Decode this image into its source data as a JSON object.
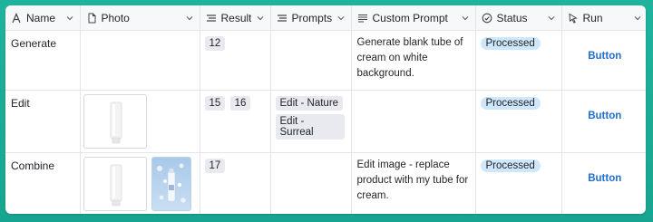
{
  "columns": [
    {
      "label": "Name",
      "icon": "text-icon"
    },
    {
      "label": "Photo",
      "icon": "document-icon"
    },
    {
      "label": "Results",
      "icon": "list-icon"
    },
    {
      "label": "Prompts",
      "icon": "list-icon"
    },
    {
      "label": "Custom Prompt",
      "icon": "paragraph-icon"
    },
    {
      "label": "Status",
      "icon": "status-circle-icon"
    },
    {
      "label": "Run",
      "icon": "cursor-icon"
    }
  ],
  "rows": [
    {
      "name": "Generate",
      "results": [
        "12"
      ],
      "prompts": [],
      "custom_prompt": "Generate blank tube of cream on white background.",
      "status": "Processed",
      "run_label": "Button"
    },
    {
      "name": "Edit",
      "results": [
        "15",
        "16"
      ],
      "prompts": [
        "Edit - Nature",
        "Edit - Surreal"
      ],
      "custom_prompt": "",
      "status": "Processed",
      "run_label": "Button"
    },
    {
      "name": "Combine",
      "results": [
        "17"
      ],
      "prompts": [],
      "custom_prompt": "Edit image - replace product with my tube for cream.",
      "status": "Processed",
      "run_label": "Button"
    }
  ],
  "colors": {
    "background": "#1fb39d",
    "badge": "#cfe7fb",
    "tag": "#e8eaef",
    "button_text": "#1f6ed4"
  }
}
